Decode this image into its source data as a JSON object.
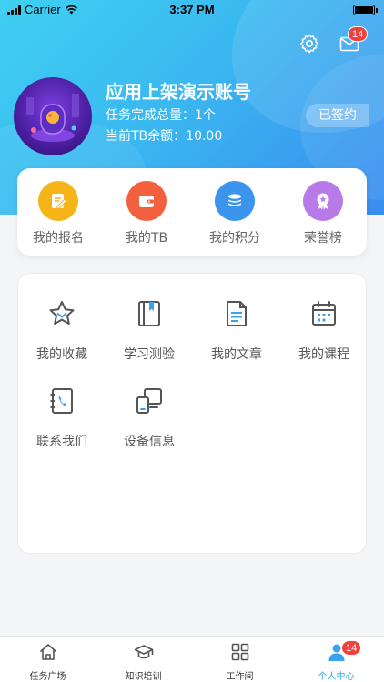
{
  "status_bar": {
    "carrier": "Carrier",
    "time": "3:37 PM"
  },
  "header": {
    "mail_badge": "14",
    "icons": {
      "settings": "gear-icon",
      "mail": "mail-icon"
    }
  },
  "profile": {
    "name": "应用上架演示账号",
    "task_total": "任务完成总量：1个",
    "tb_balance": "当前TB余额：10.00",
    "signed": "已签约"
  },
  "quick_actions": [
    {
      "label": "我的报名",
      "color": "#f5b418",
      "icon": "edit-icon"
    },
    {
      "label": "我的TB",
      "color": "#f2603f",
      "icon": "wallet-icon"
    },
    {
      "label": "我的积分",
      "color": "#3c95ec",
      "icon": "coins-icon"
    },
    {
      "label": "荣誉榜",
      "color": "#b87ae8",
      "icon": "medal-icon"
    }
  ],
  "functions": [
    {
      "label": "我的收藏",
      "icon": "star-icon"
    },
    {
      "label": "学习测验",
      "icon": "book-icon"
    },
    {
      "label": "我的文章",
      "icon": "document-icon"
    },
    {
      "label": "我的课程",
      "icon": "calendar-icon"
    },
    {
      "label": "联系我们",
      "icon": "phone-book-icon"
    },
    {
      "label": "设备信息",
      "icon": "devices-icon"
    }
  ],
  "tabs": [
    {
      "label": "任务广场",
      "icon": "home-icon",
      "active": false
    },
    {
      "label": "知识培训",
      "icon": "graduation-cap-icon",
      "active": false
    },
    {
      "label": "工作间",
      "icon": "grid-icon",
      "active": false
    },
    {
      "label": "个人中心",
      "icon": "person-icon",
      "active": true
    }
  ],
  "tab_badge": "14",
  "colors": {
    "accent": "#3aa3ef",
    "badge": "#f0413d",
    "header_start": "#3fd0f2",
    "header_end": "#3a8cf0"
  }
}
